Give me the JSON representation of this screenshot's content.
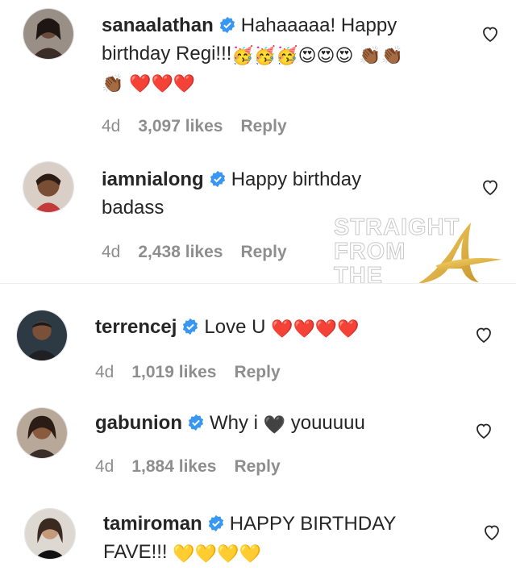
{
  "comments": [
    {
      "username": "sanaalathan",
      "line1": "Hahaaaaa! Happy",
      "line2": "birthday Regi!!!",
      "line2_emoji": "🥳🥳🥳😍😍😍 👏🏾👏🏾",
      "line3_emoji": "👏🏾",
      "line3_hearts": "❤️❤️❤️",
      "time": "4d",
      "likes": "3,097 likes",
      "reply": "Reply"
    },
    {
      "username": "iamnialong",
      "line1": "Happy birthday",
      "line2": "badass",
      "time": "4d",
      "likes": "2,438 likes",
      "reply": "Reply"
    },
    {
      "username": "terrencej",
      "line1": "Love U",
      "line1_hearts": "❤️❤️❤️❤️",
      "time": "4d",
      "likes": "1,019 likes",
      "reply": "Reply"
    },
    {
      "username": "gabunion",
      "line1_pre": "Why i",
      "line1_heart": "🖤",
      "line1_post": "youuuuu",
      "time": "4d",
      "likes": "1,884 likes",
      "reply": "Reply"
    },
    {
      "username": "tamiroman",
      "line1": "HAPPY BIRTHDAY",
      "line2": "FAVE!!!",
      "line2_hearts": "💛💛💛💛"
    }
  ],
  "watermark": {
    "line1": "STRAIGHT",
    "line2": "FROM",
    "line3": "THE",
    "logo_letter": "A"
  },
  "colors": {
    "verified_badge": "#3897f0",
    "heart_red": "#e0245e",
    "meta_gray": "#8e8e8e"
  }
}
